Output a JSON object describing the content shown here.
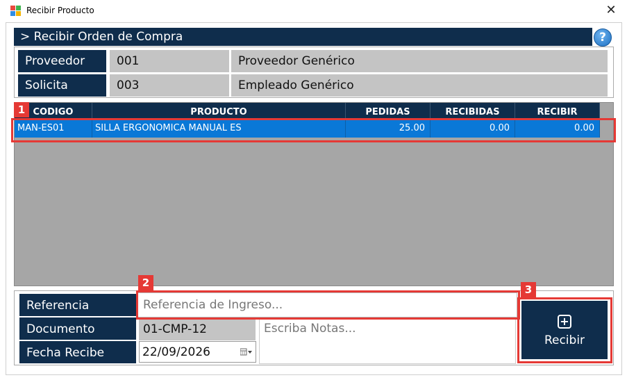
{
  "window": {
    "title": "Recibir Producto"
  },
  "header": {
    "title": "> Recibir Orden de Compra",
    "help_label": "?"
  },
  "info": {
    "proveedor_label": "Proveedor",
    "proveedor_code": "001",
    "proveedor_name": "Proveedor Genérico",
    "solicita_label": "Solicita",
    "solicita_code": "003",
    "solicita_name": "Empleado Genérico"
  },
  "grid": {
    "columns": [
      "CODIGO",
      "PRODUCTO",
      "PEDIDAS",
      "RECIBIDAS",
      "RECIBIR"
    ],
    "rows": [
      [
        "MAN-ES01",
        "SILLA ERGONOMICA MANUAL ES",
        "25.00",
        "0.00",
        "0.00"
      ]
    ]
  },
  "form": {
    "referencia_label": "Referencia",
    "referencia_placeholder": "Referencia de Ingreso...",
    "documento_label": "Documento",
    "documento_value": "01-CMP-12",
    "fecha_label": "Fecha Recibe",
    "fecha_value": "22/09/2026",
    "notas_placeholder": "Escriba Notas...",
    "recibir_label": "Recibir"
  },
  "annotations": [
    "1",
    "2",
    "3"
  ],
  "colors": {
    "navy": "#0f2d4c",
    "selected": "#0a78d7",
    "highlight": "#e53935",
    "value_gray": "#c4c4c4"
  }
}
